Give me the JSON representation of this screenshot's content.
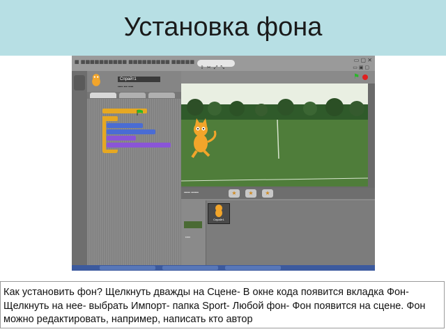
{
  "slide": {
    "title": "Установка фона",
    "caption": "Как установить фон? Щелкнуть дважды на Сцене- В окне кода появится вкладка Фон- Щелкнуть на нее- выбрать Импорт- папка Sport- Любой фон- Фон появится на сцене. Фон можно редактировать, например, написать кто автор"
  },
  "colors": {
    "header_bg": "#b7dfe4",
    "scratch_gray": "#5c5c5c",
    "block_yellow": "#e6a822",
    "block_blue": "#4a6cd4",
    "block_purple": "#8a55d7",
    "grass": "#4f7d3a"
  },
  "screenshot": {
    "sprite_name": "Спрайт1"
  }
}
